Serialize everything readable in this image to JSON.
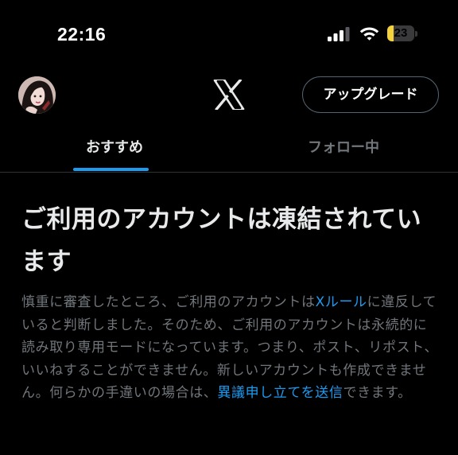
{
  "status_bar": {
    "time": "22:16",
    "battery_level": "23",
    "battery_fraction": 0.23,
    "battery_color": "#f4d23c"
  },
  "top_bar": {
    "logo_icon": "x-logo-icon",
    "upgrade_label": "アップグレード"
  },
  "tabs": [
    {
      "label": "おすすめ",
      "active": true
    },
    {
      "label": "フォロー中",
      "active": false
    }
  ],
  "notice": {
    "title": "ご利用のアカウントは凍結されています",
    "body_part1": "慎重に審査したところ、ご利用のアカウントは",
    "rules_link": "Xルール",
    "body_part2": "に違反していると判断しました。そのため、ご利用のアカウントは永続的に読み取り専用モードになっています。つまり、ポスト、リポスト、いいねすることができません。新しいアカウントも作成できません。何らかの手違いの場合は、",
    "appeal_link": "異議申し立てを送信",
    "body_part3": "できます。"
  },
  "colors": {
    "background": "#000000",
    "text_primary": "#e7e9ea",
    "text_secondary": "#71767b",
    "accent": "#1d9bf0",
    "border": "#536471"
  }
}
